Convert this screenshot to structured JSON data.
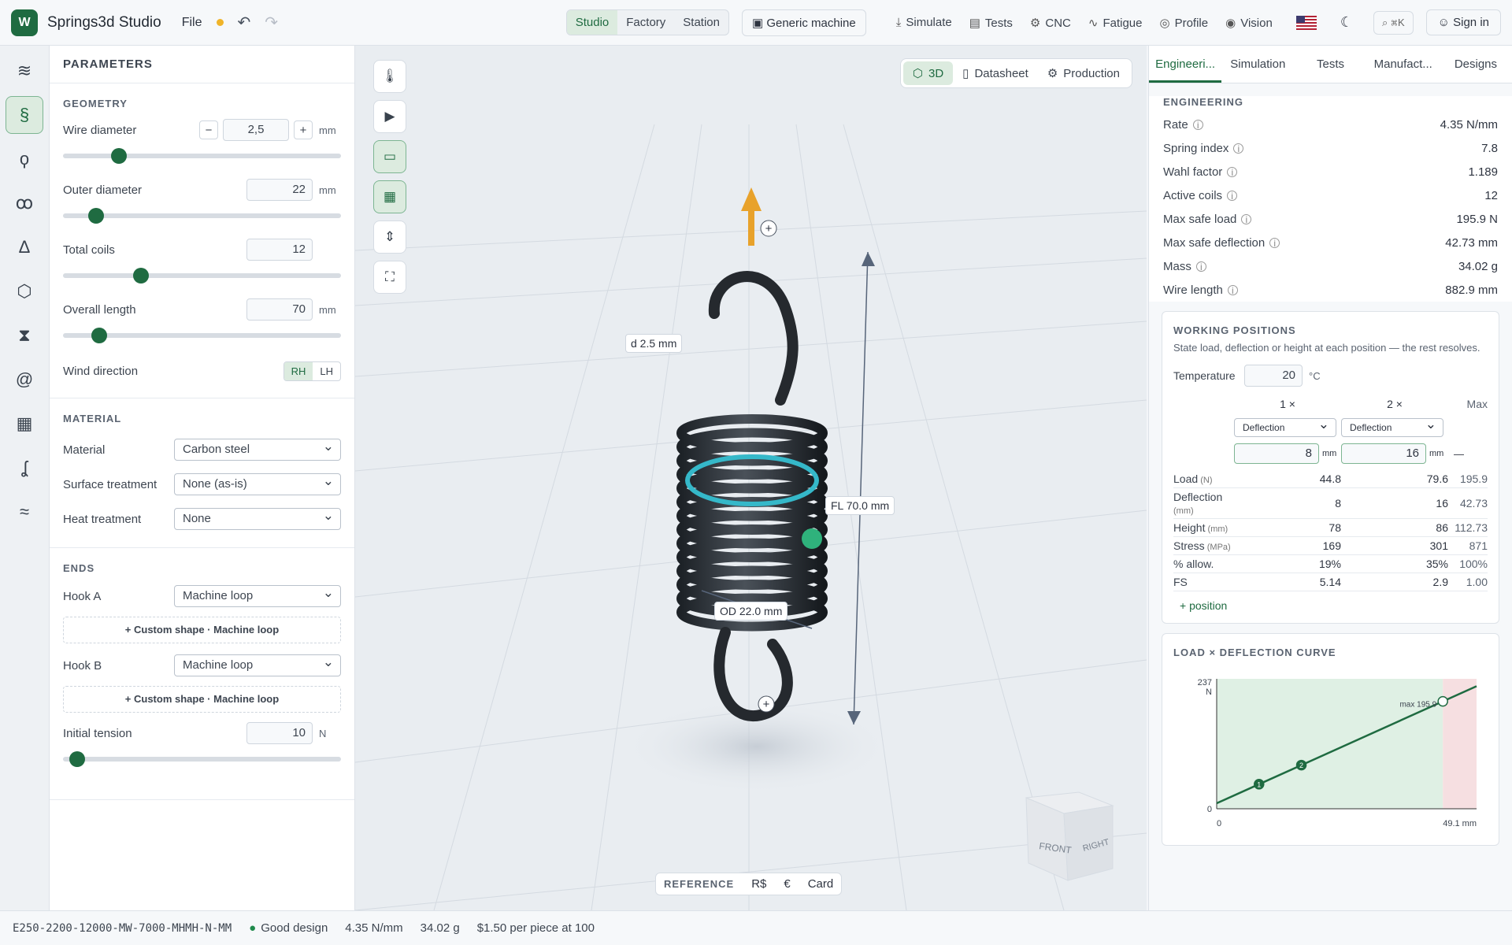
{
  "app": {
    "name": "Springs3d Studio",
    "file": "File"
  },
  "top": {
    "modes": [
      "Studio",
      "Factory",
      "Station"
    ],
    "active_mode": "Studio",
    "machine": "Generic machine",
    "nav": [
      "Simulate",
      "Tests",
      "CNC",
      "Fatigue",
      "Profile",
      "Vision"
    ],
    "search_hint": "⌘K",
    "signin": "Sign in"
  },
  "params": {
    "title": "PARAMETERS",
    "geometry": {
      "title": "GEOMETRY",
      "wire_diameter": {
        "label": "Wire diameter",
        "value": "2,5",
        "unit": "mm",
        "slider": 0.2
      },
      "outer_diameter": {
        "label": "Outer diameter",
        "value": "22",
        "unit": "mm",
        "slider": 0.12
      },
      "total_coils": {
        "label": "Total coils",
        "value": "12",
        "slider": 0.28
      },
      "overall_length": {
        "label": "Overall length",
        "value": "70",
        "unit": "mm",
        "slider": 0.13
      },
      "wind": {
        "label": "Wind direction",
        "options": [
          "RH",
          "LH"
        ],
        "selected": "RH"
      }
    },
    "material": {
      "title": "MATERIAL",
      "material": {
        "label": "Material",
        "value": "Carbon steel"
      },
      "surface": {
        "label": "Surface treatment",
        "value": "None (as-is)"
      },
      "heat": {
        "label": "Heat treatment",
        "value": "None"
      }
    },
    "ends": {
      "title": "ENDS",
      "hook_a": {
        "label": "Hook A",
        "value": "Machine loop",
        "custom": "+ Custom shape · Machine loop"
      },
      "hook_b": {
        "label": "Hook B",
        "value": "Machine loop",
        "custom": "+ Custom shape · Machine loop"
      },
      "initial_tension": {
        "label": "Initial tension",
        "value": "10",
        "unit": "N",
        "slider": 0.05
      }
    }
  },
  "viewport": {
    "tabs": [
      "3D",
      "Datasheet",
      "Production"
    ],
    "active_tab": "3D",
    "labels": {
      "d": "d 2.5 mm",
      "fl": "FL 70.0 mm",
      "od": "OD 22.0 mm"
    },
    "cube": {
      "front": "FRONT",
      "right": "RIGHT"
    },
    "reference": {
      "label": "REFERENCE",
      "options": [
        "R$",
        "€",
        "Card"
      ]
    }
  },
  "right": {
    "tabs": [
      "Engineeri...",
      "Simulation",
      "Tests",
      "Manufact...",
      "Designs"
    ],
    "active_tab": "Engineeri...",
    "engineering": {
      "title": "ENGINEERING",
      "rows": [
        {
          "k": "Rate",
          "v": "4.35 N/mm"
        },
        {
          "k": "Spring index",
          "v": "7.8"
        },
        {
          "k": "Wahl factor",
          "v": "1.189"
        },
        {
          "k": "Active coils",
          "v": "12"
        },
        {
          "k": "Max safe load",
          "v": "195.9 N"
        },
        {
          "k": "Max safe deflection",
          "v": "42.73 mm"
        },
        {
          "k": "Mass",
          "v": "34.02 g"
        },
        {
          "k": "Wire length",
          "v": "882.9 mm"
        }
      ]
    },
    "working": {
      "title": "WORKING POSITIONS",
      "desc": "State load, deflection or height at each position — the rest resolves.",
      "temp_label": "Temperature",
      "temp_value": "20",
      "temp_unit": "°C",
      "col1": "1 ×",
      "col2": "2 ×",
      "colmax": "Max",
      "mode1": "Deflection",
      "mode2": "Deflection",
      "in1": "8",
      "in2": "16",
      "in_unit": "mm",
      "in_max": "—",
      "rows": [
        {
          "k": "Load",
          "u": "(N)",
          "a": "44.8",
          "b": "79.6",
          "m": "195.9"
        },
        {
          "k": "Deflection",
          "u": "(mm)",
          "a": "8",
          "b": "16",
          "m": "42.73"
        },
        {
          "k": "Height",
          "u": "(mm)",
          "a": "78",
          "b": "86",
          "m": "112.73"
        },
        {
          "k": "Stress",
          "u": "(MPa)",
          "a": "169",
          "b": "301",
          "m": "871"
        },
        {
          "k": "% allow.",
          "u": "",
          "a": "19%",
          "b": "35%",
          "m": "100%"
        },
        {
          "k": "FS",
          "u": "",
          "a": "5.14",
          "b": "2.9",
          "m": "1.00"
        }
      ],
      "add": "+ position"
    },
    "curve": {
      "title": "LOAD × DEFLECTION CURVE",
      "ymax": "237",
      "yunit": "N",
      "y0": "0",
      "x0": "0",
      "xmax": "49.1 mm",
      "maxlabel": "max 195.9"
    }
  },
  "chart_data": {
    "type": "line",
    "title": "LOAD × DEFLECTION CURVE",
    "xlabel": "",
    "ylabel": "N",
    "xlim": [
      0,
      49.1
    ],
    "ylim": [
      0,
      237
    ],
    "series": [
      {
        "x": [
          0,
          8,
          16,
          42.73,
          49.1
        ],
        "y": [
          10,
          44.8,
          79.6,
          195.9,
          223.6
        ]
      }
    ],
    "points": [
      {
        "label": "1",
        "x": 8,
        "y": 44.8
      },
      {
        "label": "2",
        "x": 16,
        "y": 79.6
      },
      {
        "label": "max 195.9",
        "x": 42.73,
        "y": 195.9
      }
    ]
  },
  "status": {
    "code": "E250-2200-12000-MW-7000-MHMH-N-MM",
    "quality": "Good design",
    "rate": "4.35 N/mm",
    "mass": "34.02 g",
    "price": "$1.50 per piece at 100"
  },
  "colors": {
    "accent": "#1f6b41",
    "ring": "#35b8c9",
    "arrow": "#e8a22b"
  }
}
